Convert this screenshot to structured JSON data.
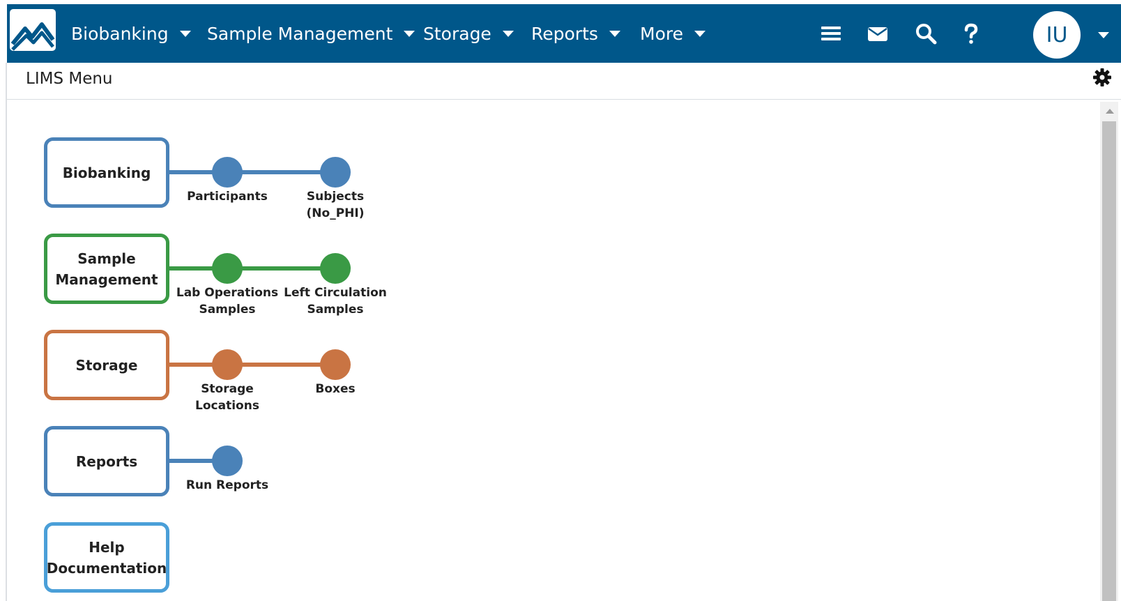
{
  "nav": {
    "items": [
      {
        "label": "Biobanking"
      },
      {
        "label": "Sample Management"
      },
      {
        "label": "Storage"
      },
      {
        "label": "Reports"
      },
      {
        "label": "More"
      }
    ],
    "user_initials": "IU"
  },
  "subheader": {
    "title": "LIMS Menu"
  },
  "colors": {
    "nav_bg": "#00578a",
    "biobanking": "#4a82b8",
    "sample_management": "#3a9a45",
    "storage": "#c97443",
    "reports": "#4a82b8",
    "help": "#4a9fd8"
  },
  "modules": [
    {
      "lines": [
        "Biobanking"
      ],
      "nodes": [
        {
          "lines": [
            "Participants"
          ]
        },
        {
          "lines": [
            "Subjects",
            "(No_PHI)"
          ]
        }
      ]
    },
    {
      "lines": [
        "Sample",
        "Management"
      ],
      "nodes": [
        {
          "lines": [
            "Lab Operations",
            "Samples"
          ]
        },
        {
          "lines": [
            "Left Circulation",
            "Samples"
          ]
        }
      ]
    },
    {
      "lines": [
        "Storage"
      ],
      "nodes": [
        {
          "lines": [
            "Storage",
            "Locations"
          ]
        },
        {
          "lines": [
            "Boxes"
          ]
        }
      ]
    },
    {
      "lines": [
        "Reports"
      ],
      "nodes": [
        {
          "lines": [
            "Run Reports"
          ]
        }
      ]
    },
    {
      "lines": [
        "Help",
        "Documentation"
      ],
      "nodes": []
    }
  ]
}
